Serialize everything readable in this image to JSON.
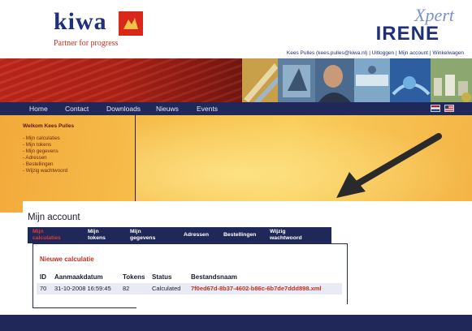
{
  "header": {
    "logo_word": "kiwa",
    "logo_tagline": "Partner for progress",
    "product_sup": "Xpert",
    "product_name": "IRENE",
    "top_links": {
      "user": "Kees Pulles (kees.pulles@kiwa.nl)",
      "logout": "Uitloggen",
      "account": "Mijn account",
      "cart": "Winkelwagen",
      "separator": "|"
    }
  },
  "nav": {
    "items": [
      "Home",
      "Contact",
      "Downloads",
      "Nieuws",
      "Events"
    ],
    "flags": [
      "flag-nl-icon",
      "flag-us-icon"
    ]
  },
  "sidebar": {
    "welcome": "Welkom Kees Pulles",
    "links": [
      "- Mijn calculaties",
      "- Mijn tokens",
      "- Mijn gegevens",
      "- Adressen",
      "- Bestellingen",
      "- Wijzig wachtwoord"
    ]
  },
  "main": {
    "title": "Mijn account",
    "tabs": [
      {
        "line1": "Mijn",
        "line2": "calculaties",
        "active": true
      },
      {
        "line1": "Mijn",
        "line2": "tokens",
        "active": false
      },
      {
        "line1": "Mijn",
        "line2": "gegevens",
        "active": false
      },
      {
        "line1": "Adressen",
        "line2": "",
        "active": false
      },
      {
        "line1": "Bestellingen",
        "line2": "",
        "active": false
      },
      {
        "line1": "Wijzig",
        "line2": "wachtwoord",
        "active": false
      }
    ],
    "new_calc": "Nieuwe calculatie",
    "table": {
      "headers": [
        "ID",
        "Aanmaakdatum",
        "Tokens",
        "Status",
        "Bestandsnaam"
      ],
      "rows": [
        [
          "70",
          "31-10-2008 16:59:45",
          "82",
          "Calculated",
          "7f0ed67d-8b37-4602-b86c-6b7de7ddd898.xml"
        ]
      ]
    }
  },
  "colors": {
    "navy": "#20285a",
    "accent_red": "#c23120",
    "orange": "#f7c04d"
  }
}
